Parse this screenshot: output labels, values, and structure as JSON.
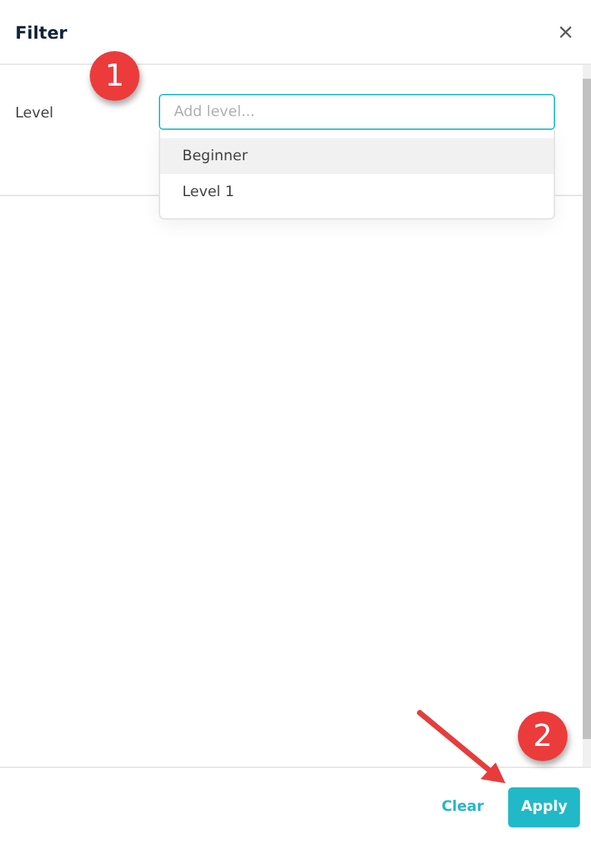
{
  "dialog": {
    "title": "Filter",
    "close": "×"
  },
  "fields": [
    {
      "label": "Level",
      "placeholder": "Add level...",
      "options": [
        {
          "label": "Beginner",
          "highlighted": true
        },
        {
          "label": "Level 1",
          "highlighted": false
        }
      ]
    }
  ],
  "footer": {
    "buttons": [
      {
        "label": "Clear",
        "kind": "link"
      },
      {
        "label": "Apply",
        "kind": "primary"
      }
    ]
  },
  "annotations": [
    {
      "number": "1"
    },
    {
      "number": "2"
    }
  ]
}
